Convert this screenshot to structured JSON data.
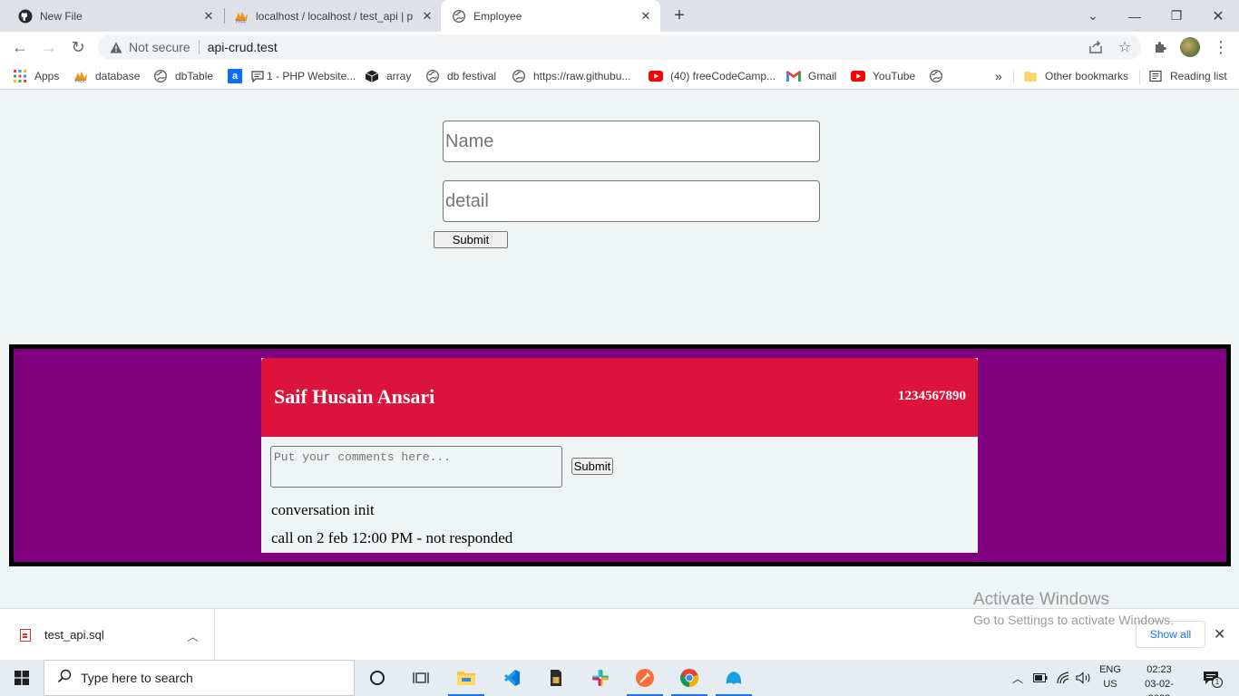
{
  "browser": {
    "tabs": [
      {
        "label": "New File",
        "icon": "github-icon",
        "active": false
      },
      {
        "label": "localhost / localhost / test_api | p",
        "icon": "phpmyadmin-icon",
        "active": false
      },
      {
        "label": "Employee",
        "icon": "globe-icon",
        "active": true
      }
    ],
    "omnibox": {
      "security_label": "Not secure",
      "url": "api-crud.test"
    },
    "bookmarks": [
      {
        "label": "Apps",
        "icon": "apps-grid-icon"
      },
      {
        "label": "database",
        "icon": "phpmyadmin-icon"
      },
      {
        "label": "dbTable",
        "icon": "globe-icon"
      },
      {
        "label": "",
        "icon": "a-icon"
      },
      {
        "label": "1 - PHP Website...",
        "icon": "chat-icon"
      },
      {
        "label": "array",
        "icon": "cube-icon"
      },
      {
        "label": "db festival",
        "icon": "globe-icon"
      },
      {
        "label": "https://raw.githubu...",
        "icon": "globe-icon"
      },
      {
        "label": "(40) freeCodeCamp...",
        "icon": "youtube-icon"
      },
      {
        "label": "Gmail",
        "icon": "gmail-icon"
      },
      {
        "label": "YouTube",
        "icon": "youtube-icon"
      },
      {
        "label": "",
        "icon": "globe-icon"
      }
    ],
    "bookmarks_overflow": "»",
    "other_bookmarks": "Other bookmarks",
    "reading_list": "Reading list"
  },
  "form": {
    "name_placeholder": "Name",
    "detail_placeholder": "detail",
    "submit_label": "Submit"
  },
  "card": {
    "name": "Saif Husain Ansari",
    "phone": "1234567890",
    "comment_placeholder": "Put your comments here...",
    "submit_label": "Submit",
    "notes": [
      "conversation init",
      "call on 2 feb 12:00 PM - not responded"
    ]
  },
  "colors": {
    "outer_bg": "#800080",
    "card_header": "#dc143c",
    "page_bg": "#eff5f5"
  },
  "downloads": {
    "file_name": "test_api.sql",
    "show_all": "Show all"
  },
  "watermark": {
    "line1": "Activate Windows",
    "line2": "Go to Settings to activate Windows."
  },
  "taskbar": {
    "search_placeholder": "Type here to search",
    "lang_line1": "ENG",
    "lang_line2": "US",
    "time": "02:23",
    "date": "03-02-2022",
    "notification_count": "1"
  }
}
